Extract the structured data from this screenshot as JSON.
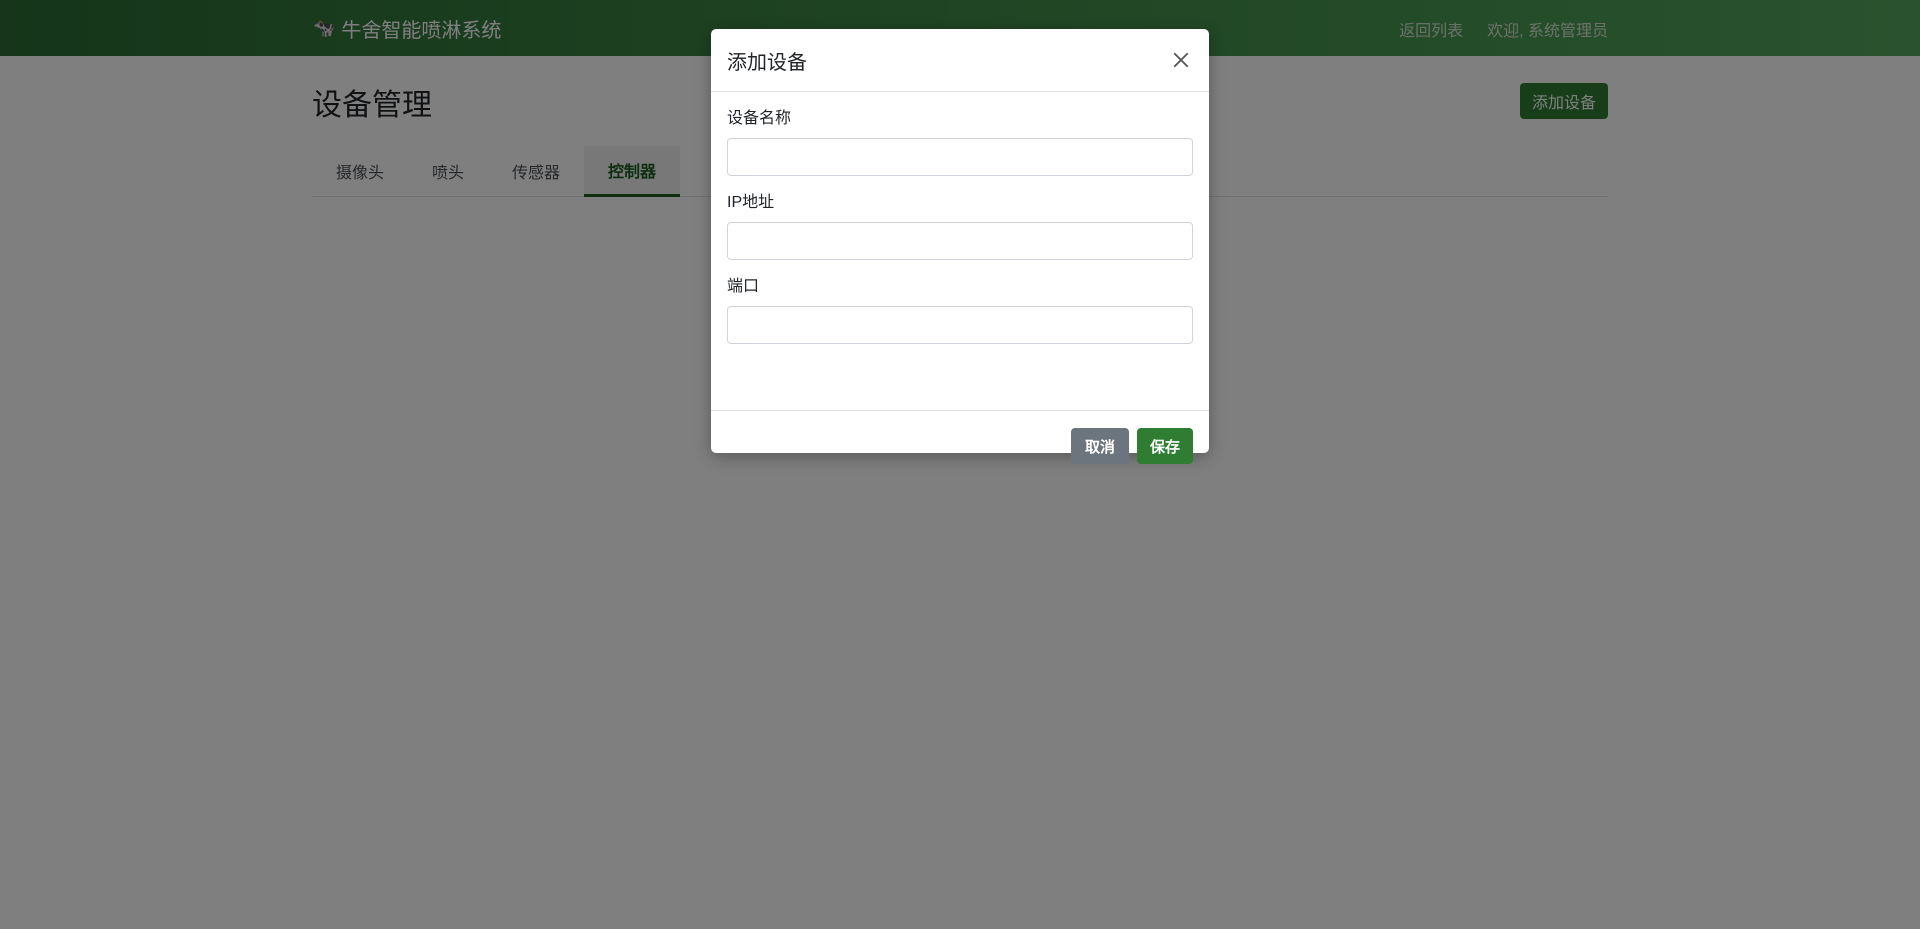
{
  "navbar": {
    "brand_icon": "cow-icon",
    "brand": "牛舍智能喷淋系统",
    "links": [
      "返回列表",
      "欢迎, 系统管理员"
    ]
  },
  "page": {
    "title": "设备管理",
    "add_button": "添加设备"
  },
  "tabs": [
    {
      "label": "摄像头",
      "active": false
    },
    {
      "label": "喷头",
      "active": false
    },
    {
      "label": "传感器",
      "active": false
    },
    {
      "label": "控制器",
      "active": true
    }
  ],
  "modal": {
    "title": "添加设备",
    "fields": [
      {
        "label": "设备名称",
        "value": "",
        "placeholder": ""
      },
      {
        "label": "IP地址",
        "value": "",
        "placeholder": ""
      },
      {
        "label": "端口",
        "value": "",
        "placeholder": ""
      }
    ],
    "cancel": "取消",
    "save": "保存"
  },
  "colors": {
    "primary": "#2e7d32",
    "secondary": "#6c757d",
    "backdrop": "rgba(0,0,0,0.5)"
  }
}
